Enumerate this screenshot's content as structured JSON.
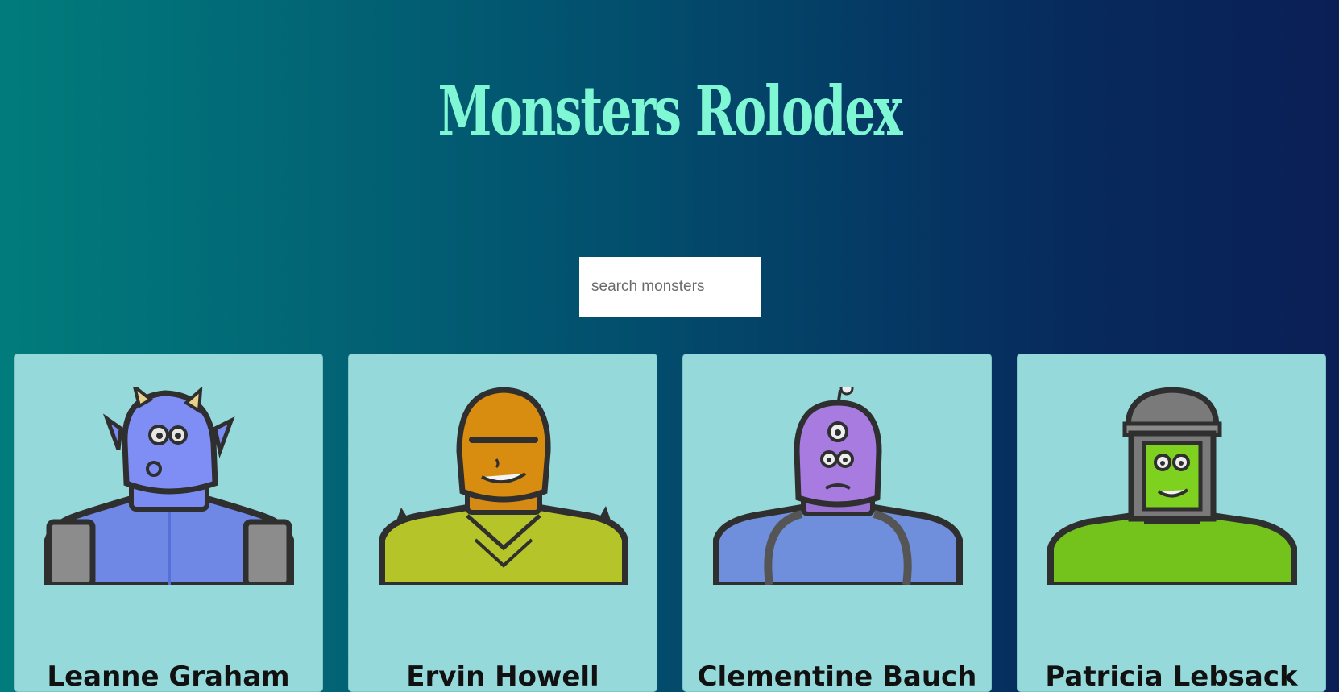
{
  "app": {
    "title": "Monsters Rolodex"
  },
  "search": {
    "placeholder": "search monsters",
    "value": ""
  },
  "cards": [
    {
      "name": "Leanne Graham"
    },
    {
      "name": "Ervin Howell"
    },
    {
      "name": "Clementine Bauch"
    },
    {
      "name": "Patricia Lebsack"
    }
  ],
  "colors": {
    "title": "#7ff7d4",
    "card_background": "#95d9da",
    "gradient_start": "#017c7c",
    "gradient_end": "#0a1f55"
  }
}
